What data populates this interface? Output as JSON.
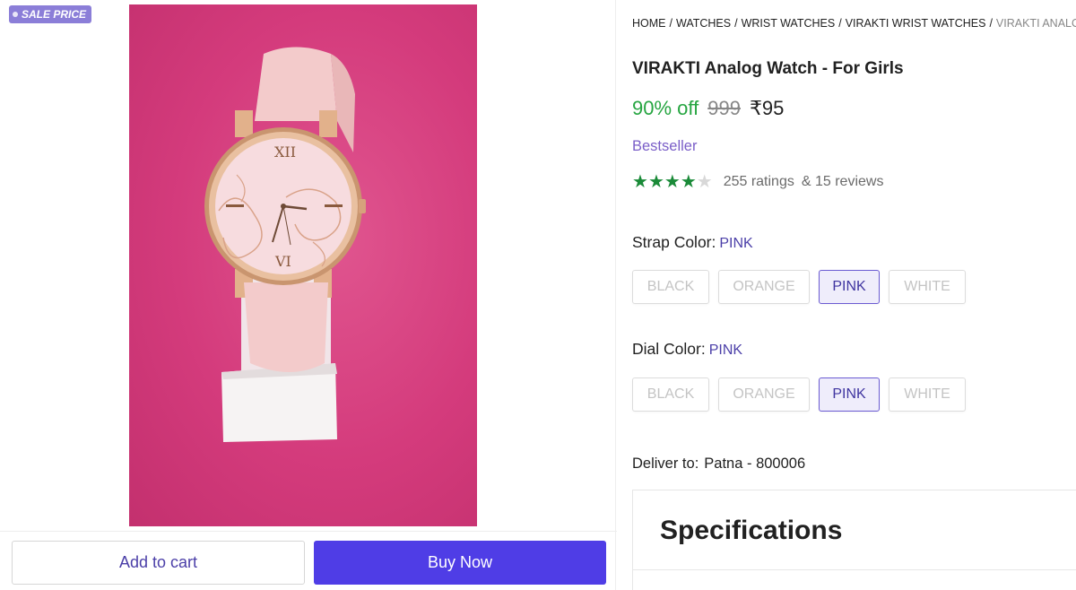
{
  "badge": {
    "label": "SALE PRICE"
  },
  "breadcrumb": {
    "items": [
      "HOME",
      "WATCHES",
      "WRIST WATCHES",
      "VIRAKTI WRIST WATCHES"
    ],
    "current": "VIRAKTI ANALOG W"
  },
  "product": {
    "title": "VIRAKTI Analog Watch  - For Girls",
    "discount": "90% off",
    "mrp": "999",
    "price": "₹95",
    "tag": "Bestseller",
    "rating_stars": 4,
    "ratings_text": "255 ratings",
    "reviews_text": "& 15 reviews"
  },
  "strap": {
    "label": "Strap Color:",
    "value": "PINK",
    "options": [
      "BLACK",
      "ORANGE",
      "PINK",
      "WHITE"
    ],
    "selected": "PINK"
  },
  "dial": {
    "label": "Dial Color:",
    "value": "PINK",
    "options": [
      "BLACK",
      "ORANGE",
      "PINK",
      "WHITE"
    ],
    "selected": "PINK"
  },
  "delivery": {
    "label": "Deliver to:",
    "location": "Patna - 800006"
  },
  "specs": {
    "title": "Specifications"
  },
  "actions": {
    "add_to_cart": "Add to cart",
    "buy_now": "Buy Now"
  },
  "colors": {
    "accent": "#4f3de6",
    "discount_green": "#26a541",
    "star_green": "#1a8a38",
    "bestseller_purple": "#7b5fc8",
    "badge_purple": "#8b7ed8",
    "image_bg_pink": "#d43b7c"
  },
  "icons": {
    "star_full": "★",
    "star_empty": "★"
  }
}
